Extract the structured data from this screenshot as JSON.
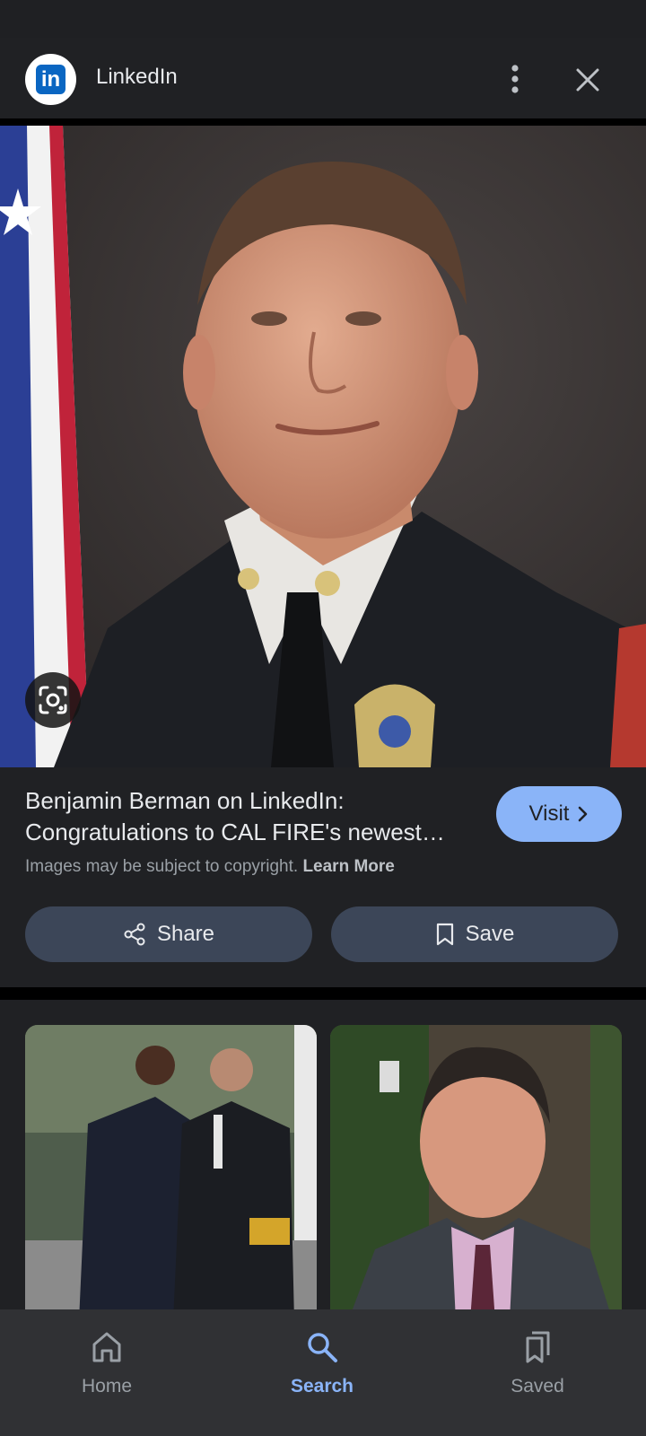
{
  "header": {
    "logo_text": "in",
    "site_name": "LinkedIn",
    "icons": {
      "more": "more-vert-icon",
      "close": "close-icon"
    }
  },
  "main_image": {
    "lens_icon": "google-lens-icon"
  },
  "result": {
    "title": "Benjamin Berman on LinkedIn: Congratulations to CAL FIRE's newest Assistant Chief",
    "visit_label": "Visit",
    "copyright_text": "Images may be subject to copyright.",
    "learn_more": "Learn More",
    "share_label": "Share",
    "save_label": "Save"
  },
  "bottom_nav": {
    "items": [
      {
        "label": "Home",
        "icon": "home-icon"
      },
      {
        "label": "Search",
        "icon": "search-icon"
      },
      {
        "label": "Saved",
        "icon": "saved-icon"
      }
    ]
  },
  "colors": {
    "background": "#202124",
    "accent": "#8ab4f8",
    "button_bg": "#3c4658",
    "linkedin_blue": "#0a66c2"
  }
}
